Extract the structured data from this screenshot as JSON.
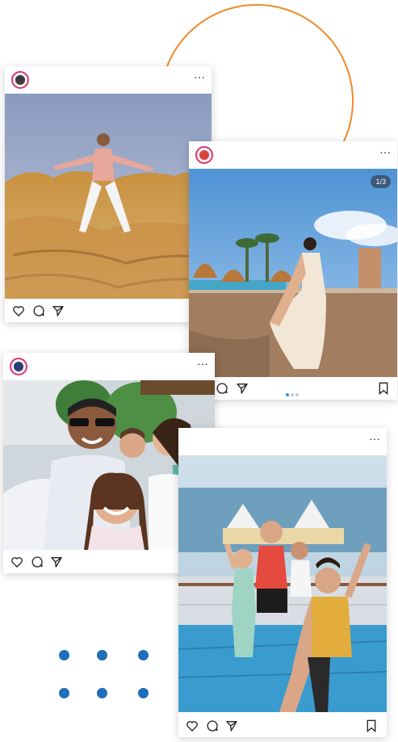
{
  "decor": {
    "accent_color": "#ef8a2b",
    "dot_color": "#1e6fb8"
  },
  "posts": [
    {
      "id": "hiker",
      "avatar_icon": "man-avatar-icon",
      "more_label": "···",
      "actions": [
        "heart-icon",
        "comment-icon",
        "share-icon"
      ],
      "photo_description_icon": "man-on-rocks-photo"
    },
    {
      "id": "dress",
      "avatar_icon": "red-avatar-icon",
      "more_label": "···",
      "counter": "1/3",
      "actions": [
        "comment-icon",
        "share-icon",
        "bookmark-icon"
      ],
      "carousel_active": 1,
      "carousel_total": 3,
      "photo_description_icon": "woman-in-dress-photo"
    },
    {
      "id": "family",
      "avatar_icon": "man-avatar-icon",
      "more_label": "···",
      "actions": [
        "heart-icon",
        "comment-icon",
        "share-icon",
        "bookmark-icon"
      ],
      "photo_description_icon": "family-selfie-photo"
    },
    {
      "id": "friends",
      "more_label": "···",
      "actions": [
        "heart-icon",
        "comment-icon",
        "share-icon",
        "bookmark-icon"
      ],
      "photo_description_icon": "friends-ship-selfie-photo"
    }
  ]
}
